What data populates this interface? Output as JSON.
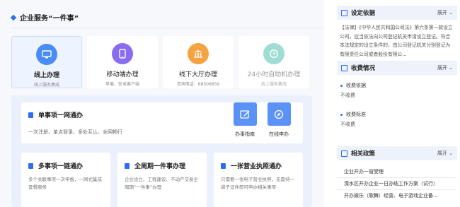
{
  "main": {
    "title": "企业服务“一件事”",
    "cards": [
      {
        "title": "线上办理",
        "sub": "线上服务集成",
        "icon": "monitor-icon",
        "color": "#4a8cf7"
      },
      {
        "title": "移动端办理",
        "sub": "苹果、安卓客户端",
        "icon": "phone-icon",
        "color": "#8a6cf0"
      },
      {
        "title": "线下大厅办理",
        "sub": "咨询电话：68506850",
        "icon": "building-icon",
        "color": "#f5a341"
      },
      {
        "title": "24小时自助机办理",
        "sub": "线上服务集成",
        "icon": "clock-icon",
        "color": "#4cc3b5"
      }
    ],
    "single": {
      "title": "单事项一网通办",
      "desc": "一次注册、单点登录、多处互认、全网畅行"
    },
    "quick": {
      "guide": "办事指南",
      "apply": "在线申办"
    },
    "sub_cards": [
      {
        "title": "多事项一链通办",
        "desc": "多个关联事项一次申报，一网式集成套餐服务"
      },
      {
        "title": "全周期一件事办理",
        "desc": "企业设立、工程建设、不动产交易全周期“一件事”办理"
      },
      {
        "title": "一张营业执照通办",
        "desc": "只需要一张电子营业执照，无需持一袋子证件即可申办相关事项"
      }
    ]
  },
  "sidebar": {
    "basis": {
      "title": "设定依据",
      "more": "展开",
      "text": "【法律】《中华人民共和国公司法》第六条第一款设立公司，应当依法向公司登记机关申请设立登记。符合本法规定的设立条件的，由公司登记机关分别登记为有限责任公司或者股份有限公..."
    },
    "fee": {
      "title": "收费情况",
      "more": "展开",
      "basis_label": "收费依据",
      "basis_value": "不收费",
      "standard_label": "收费标准",
      "standard_value": "不收费"
    },
    "policy": {
      "title": "相关政策",
      "more": "展开",
      "items": [
        "企业开办一窗受理",
        "溧水区开办企业一日办结工作方案（试行）",
        "开办娱乐（歌舞）经营、电子游戏企业备..."
      ]
    }
  }
}
